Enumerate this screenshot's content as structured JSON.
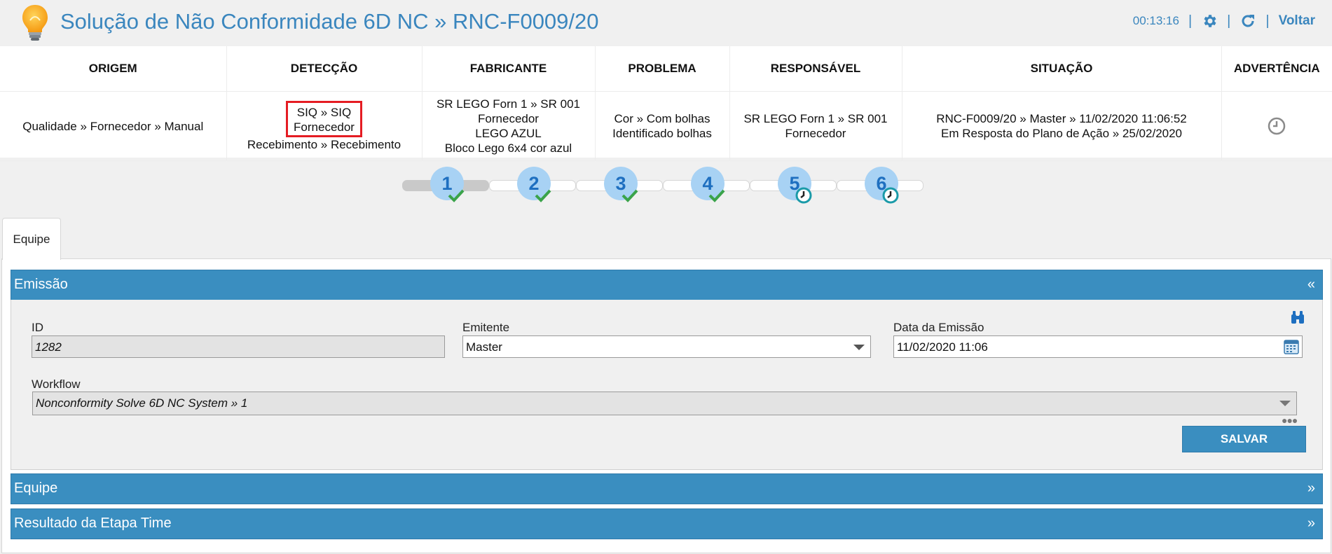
{
  "header": {
    "title": "Solução de Não Conformidade 6D NC » RNC-F0009/20",
    "timer": "00:13:16",
    "voltar": "Voltar",
    "separator": "|"
  },
  "info_table": {
    "headers": [
      "ORIGEM",
      "DETECÇÃO",
      "FABRICANTE",
      "PROBLEMA",
      "RESPONSÁVEL",
      "SITUAÇÃO",
      "ADVERTÊNCIA"
    ],
    "origem": "Qualidade » Fornecedor » Manual",
    "deteccao": {
      "line1": "SIQ » SIQ",
      "line2": "Fornecedor",
      "line3": "Recebimento » Recebimento"
    },
    "fabricante": {
      "line1": "SR LEGO Forn 1 » SR 001",
      "line2": "Fornecedor",
      "line3": "LEGO AZUL",
      "line4": "Bloco Lego 6x4 cor azul"
    },
    "problema": {
      "line1": "Cor » Com bolhas",
      "line2": "Identificado bolhas"
    },
    "responsavel": {
      "line1": "SR LEGO Forn 1 » SR 001",
      "line2": "Fornecedor"
    },
    "situacao": {
      "line1": "RNC-F0009/20 » Master » 11/02/2020 11:06:52",
      "line2": "Em Resposta do Plano de Ação » 25/02/2020"
    },
    "advertencia_icon": "clock-icon"
  },
  "steps": {
    "progress_fraction": 0.166,
    "items": [
      {
        "number": "1",
        "status": "completed",
        "icon": "check-icon"
      },
      {
        "number": "2",
        "status": "completed",
        "icon": "check-icon"
      },
      {
        "number": "3",
        "status": "completed",
        "icon": "check-icon"
      },
      {
        "number": "4",
        "status": "completed",
        "icon": "check-icon"
      },
      {
        "number": "5",
        "status": "pending",
        "icon": "clock-icon"
      },
      {
        "number": "6",
        "status": "pending",
        "icon": "clock-icon"
      }
    ]
  },
  "tabs": [
    {
      "label": "Equipe",
      "active": true
    }
  ],
  "sections": {
    "emissao": {
      "title": "Emissão",
      "arrow": "«"
    },
    "equipe": {
      "title": "Equipe",
      "arrow": "»"
    },
    "resultado": {
      "title": "Resultado da Etapa Time",
      "arrow": "»"
    }
  },
  "form": {
    "id_label": "ID",
    "id_value": "1282",
    "emitente_label": "Emitente",
    "emitente_value": "Master",
    "data_label": "Data da Emissão",
    "data_value": "11/02/2020 11:06",
    "workflow_label": "Workflow",
    "workflow_value": "Nonconformity Solve 6D NC System » 1",
    "save_label": "SALVAR"
  },
  "colors": {
    "accent": "#3a8ec0",
    "title": "#3a86be",
    "step_circle": "#a8d2f4",
    "step_number": "#1e6fc0",
    "check": "#3aa34a",
    "pending_clock": "#1a9aa8",
    "highlight": "#e51c23"
  }
}
